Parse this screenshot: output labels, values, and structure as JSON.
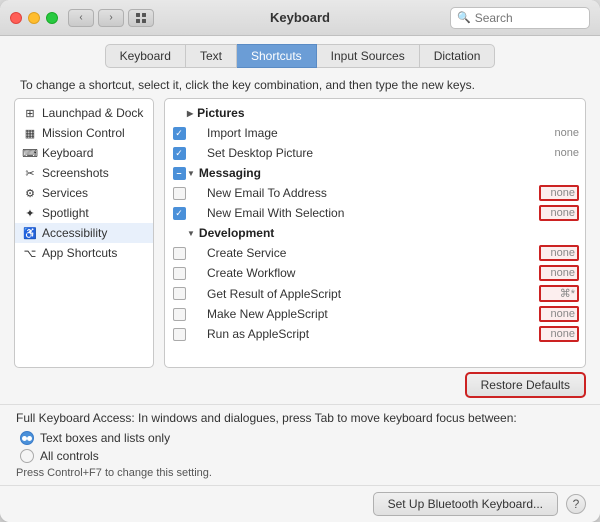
{
  "window": {
    "title": "Keyboard"
  },
  "search": {
    "placeholder": "Search"
  },
  "tabs": [
    {
      "label": "Keyboard",
      "active": false
    },
    {
      "label": "Text",
      "active": false
    },
    {
      "label": "Shortcuts",
      "active": true
    },
    {
      "label": "Input Sources",
      "active": false
    },
    {
      "label": "Dictation",
      "active": false
    }
  ],
  "instruction": "To change a shortcut, select it, click the key combination, and then type the new keys.",
  "sidebar": {
    "items": [
      {
        "label": "Launchpad & Dock",
        "icon": "⊞"
      },
      {
        "label": "Mission Control",
        "icon": "▦"
      },
      {
        "label": "Keyboard",
        "icon": "⌨"
      },
      {
        "label": "Screenshots",
        "icon": "✂"
      },
      {
        "label": "Services",
        "icon": "⚙"
      },
      {
        "label": "Spotlight",
        "icon": "✦"
      },
      {
        "label": "Accessibility",
        "icon": "♿",
        "selected": true
      },
      {
        "label": "App Shortcuts",
        "icon": "🔧"
      }
    ]
  },
  "shortcuts": {
    "categories": [
      {
        "type": "category",
        "label": "Pictures",
        "collapsed": false,
        "items": [
          {
            "label": "Import Image",
            "checked": true,
            "key": "none"
          },
          {
            "label": "Set Desktop Picture",
            "checked": true,
            "key": "none"
          }
        ]
      },
      {
        "type": "category",
        "label": "Messaging",
        "collapsed": false,
        "items": [
          {
            "label": "New Email To Address",
            "checked": false,
            "key": "none",
            "highlight": true
          },
          {
            "label": "New Email With Selection",
            "checked": true,
            "key": "none",
            "highlight": true
          }
        ]
      },
      {
        "type": "category",
        "label": "Development",
        "collapsed": false,
        "items": [
          {
            "label": "Create Service",
            "checked": false,
            "key": "none",
            "highlight": true
          },
          {
            "label": "Create Workflow",
            "checked": false,
            "key": "none",
            "highlight": true
          },
          {
            "label": "Get Result of AppleScript",
            "checked": false,
            "key": "⌘*",
            "highlight": true
          },
          {
            "label": "Make New AppleScript",
            "checked": false,
            "key": "none",
            "highlight": true
          },
          {
            "label": "Run as AppleScript",
            "checked": false,
            "key": "none",
            "highlight": true
          }
        ]
      }
    ]
  },
  "buttons": {
    "restore_defaults": "Restore Defaults",
    "bluetooth": "Set Up Bluetooth Keyboard...",
    "help": "?"
  },
  "bottom": {
    "title": "Full Keyboard Access: In windows and dialogues, press Tab to move keyboard focus between:",
    "options": [
      {
        "label": "Text boxes and lists only",
        "selected": true
      },
      {
        "label": "All controls",
        "selected": false
      }
    ],
    "note": "Press Control+F7 to change this setting."
  }
}
